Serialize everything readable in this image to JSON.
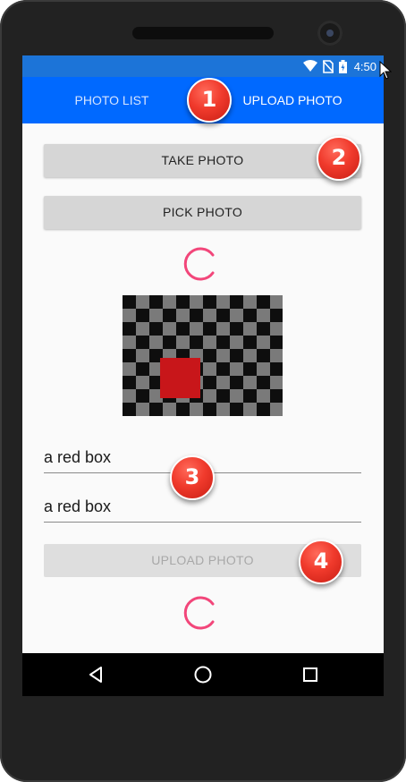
{
  "status_bar": {
    "time": "4:50",
    "icons": [
      "wifi-icon",
      "no-sim-icon",
      "battery-charging-icon"
    ]
  },
  "tabs": [
    {
      "label": "PHOTO LIST"
    },
    {
      "label": "UPLOAD PHOTO"
    }
  ],
  "main": {
    "take_photo_label": "TAKE PHOTO",
    "pick_photo_label": "PICK PHOTO",
    "photo_image": "checkerboard-with-red-box",
    "title_value": "a red box",
    "description_value": "a red box",
    "upload_label": "UPLOAD PHOTO"
  },
  "annotations": [
    "1",
    "2",
    "3",
    "4"
  ],
  "nav_bar": {
    "icons": [
      "back-icon",
      "home-icon",
      "recents-icon"
    ]
  },
  "colors": {
    "tabbar": "#0069ff",
    "statusbar": "#1c74d8",
    "spinner": "#f2467a",
    "badge": "#f03a2c",
    "red_box": "#c8161a"
  }
}
